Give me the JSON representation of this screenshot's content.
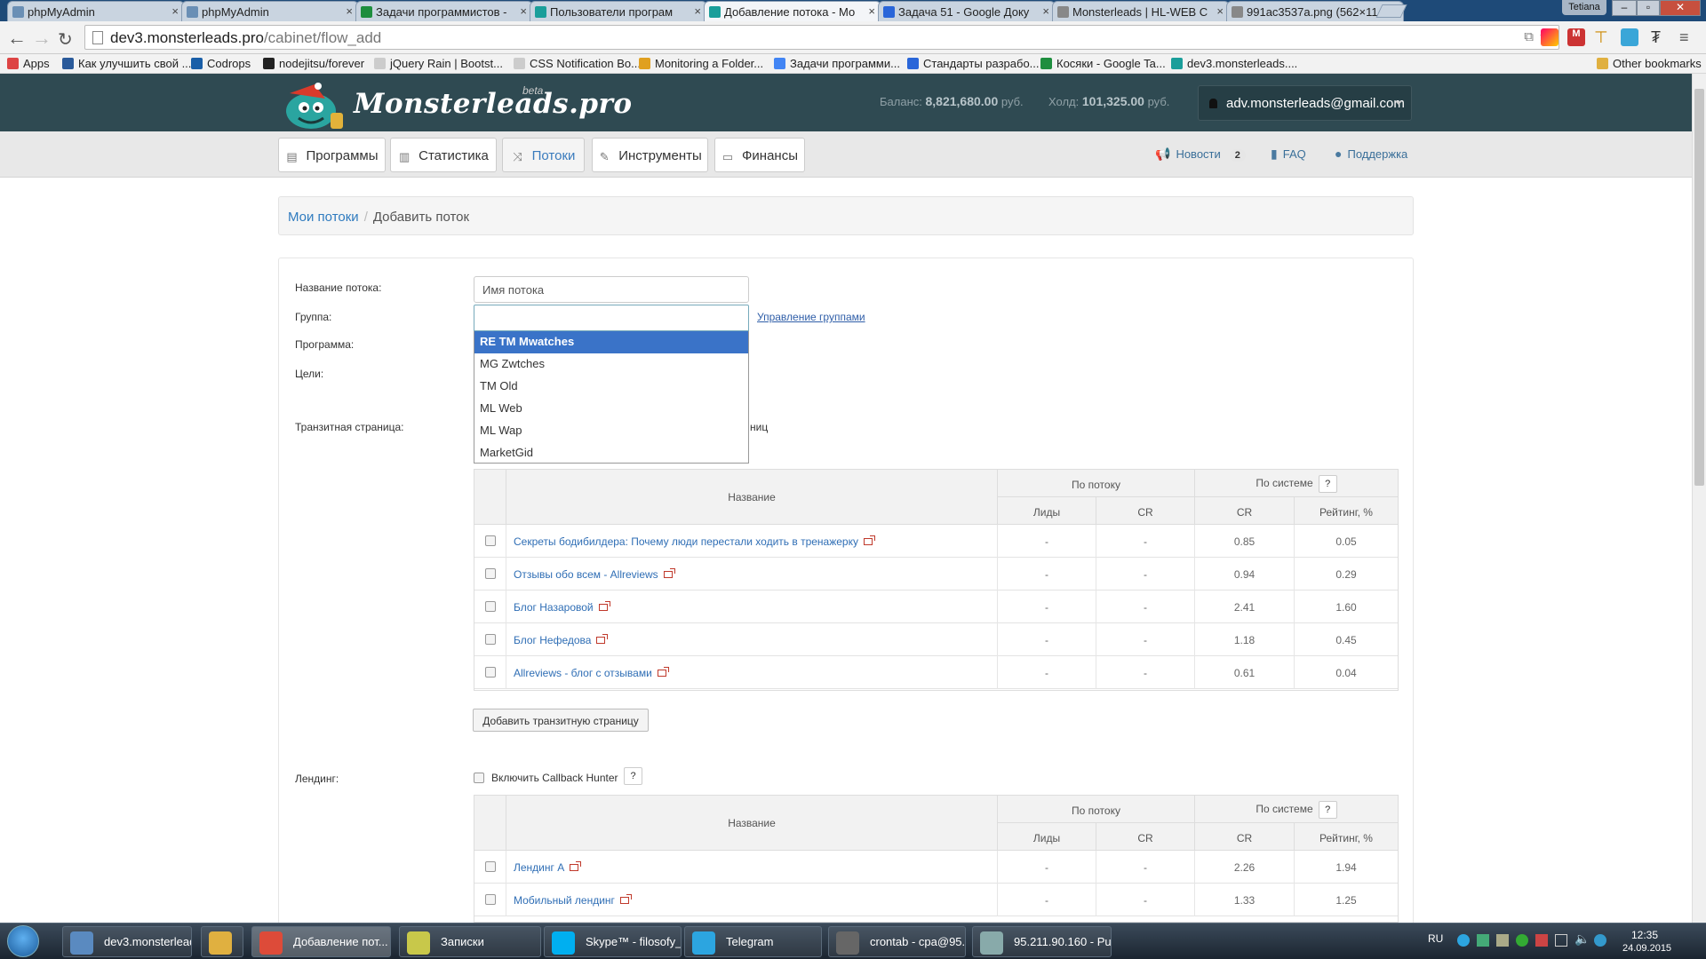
{
  "browser": {
    "tabs": [
      {
        "label": "phpMyAdmin",
        "color": "#6a8fb5"
      },
      {
        "label": "phpMyAdmin",
        "color": "#6a8fb5"
      },
      {
        "label": "Задачи программистов -",
        "color": "#1e8e3e"
      },
      {
        "label": "Пользователи програм",
        "color": "#1a9e9a"
      },
      {
        "label": "Добавление потока - Мо",
        "color": "#1a9e9a"
      },
      {
        "label": "Задача 51 - Google Доку",
        "color": "#2a66d9"
      },
      {
        "label": "Monsterleads | HL-WEB С",
        "color": "#888888"
      },
      {
        "label": "991ac3537a.png (562×11",
        "color": "#888888"
      }
    ],
    "active_tab": 4,
    "window_user": "Tetiana",
    "url_host": "dev3.monsterleads.pro",
    "url_path": "/cabinet/flow_add",
    "bookmarks": [
      {
        "label": "Apps",
        "color": "#d44"
      },
      {
        "label": "Как улучшить свой ...",
        "color": "#2a5a9a"
      },
      {
        "label": "Codrops",
        "color": "#1a5fa8"
      },
      {
        "label": "nodejitsu/forever",
        "color": "#222222"
      },
      {
        "label": "jQuery Rain | Bootst...",
        "color": "#cccccc"
      },
      {
        "label": "CSS Notification Bo...",
        "color": "#cccccc"
      },
      {
        "label": "Monitoring a Folder...",
        "color": "#e0a020"
      },
      {
        "label": "Задачи программи...",
        "color": "#4285f4"
      },
      {
        "label": "Стандарты разрабо...",
        "color": "#2a66d9"
      },
      {
        "label": "Косяки - Google Ta...",
        "color": "#1e8e3e"
      },
      {
        "label": "dev3.monsterleads....",
        "color": "#1a9e9a"
      }
    ],
    "other_bookmarks": "Other bookmarks"
  },
  "header": {
    "logo": "Monsterleads.pro",
    "beta": "beta",
    "balance_label": "Баланс:",
    "balance_value": "8,821,680.00",
    "currency": "руб.",
    "hold_label": "Холд:",
    "hold_value": "101,325.00",
    "account": "adv.monsterleads@gmail.com"
  },
  "nav": {
    "items": [
      "Программы",
      "Статистика",
      "Потоки",
      "Инструменты",
      "Финансы"
    ],
    "active": 2,
    "news": "Новости",
    "news_count": "2",
    "faq": "FAQ",
    "support": "Поддержка"
  },
  "breadcrumb": {
    "root": "Мои потоки",
    "current": "Добавить поток"
  },
  "form": {
    "name_label": "Название потока:",
    "name_placeholder": "Имя потока",
    "group_label": "Группа:",
    "manage_groups": "Управление группами",
    "program_label": "Программа:",
    "goals_label": "Цели:",
    "transit_label": "Транзитная страница:",
    "transit_partial": "ниц",
    "landing_label": "Лендинг:",
    "callback": "Включить Callback Hunter",
    "help": "?",
    "add_transit": "Добавить транзитную страницу"
  },
  "dropdown": {
    "options": [
      "RE TM Mwatches",
      "MG Zwtches",
      "TM Old",
      "ML Web",
      "ML Wap",
      "MarketGid"
    ],
    "selected": 0
  },
  "table_headers": {
    "name": "Название",
    "by_flow": "По потоку",
    "by_system": "По системе",
    "leads": "Лиды",
    "cr": "CR",
    "cr2": "CR",
    "rating": "Рейтинг, %"
  },
  "transit_rows": [
    {
      "name": "Секреты бодибилдера: Почему люди перестали ходить в тренажерку",
      "leads": "-",
      "cr": "-",
      "cr_sys": "0.85",
      "rating": "0.05"
    },
    {
      "name": "Отзывы обо всем - Allreviews",
      "leads": "-",
      "cr": "-",
      "cr_sys": "0.94",
      "rating": "0.29"
    },
    {
      "name": "Блог Назаровой",
      "leads": "-",
      "cr": "-",
      "cr_sys": "2.41",
      "rating": "1.60"
    },
    {
      "name": "Блог Нефедова",
      "leads": "-",
      "cr": "-",
      "cr_sys": "1.18",
      "rating": "0.45"
    },
    {
      "name": "Allreviews - блог с отзывами",
      "leads": "-",
      "cr": "-",
      "cr_sys": "0.61",
      "rating": "0.04"
    }
  ],
  "landing_rows": [
    {
      "name": "Лендинг А",
      "leads": "-",
      "cr": "-",
      "cr_sys": "2.26",
      "rating": "1.94"
    },
    {
      "name": "Мобильный лендинг",
      "leads": "-",
      "cr": "-",
      "cr_sys": "1.33",
      "rating": "1.25"
    }
  ],
  "taskbar": {
    "items": [
      {
        "label": "dev3.monsterlead...",
        "color": "#5a8ac0"
      },
      {
        "label": "",
        "color": "#e0b040"
      },
      {
        "label": "Добавление пот...",
        "color": "#dd4b39"
      },
      {
        "label": "Записки",
        "color": "#c8c84a"
      },
      {
        "label": "Skype™ - filosofy_...",
        "color": "#00aff0"
      },
      {
        "label": "Telegram",
        "color": "#2ca5e0"
      },
      {
        "label": "crontab - cpa@95....",
        "color": "#666666"
      },
      {
        "label": "95.211.90.160 - Pu...",
        "color": "#8aa"
      }
    ],
    "active": 2,
    "lang": "RU",
    "time": "12:35",
    "date": "24.09.2015"
  }
}
